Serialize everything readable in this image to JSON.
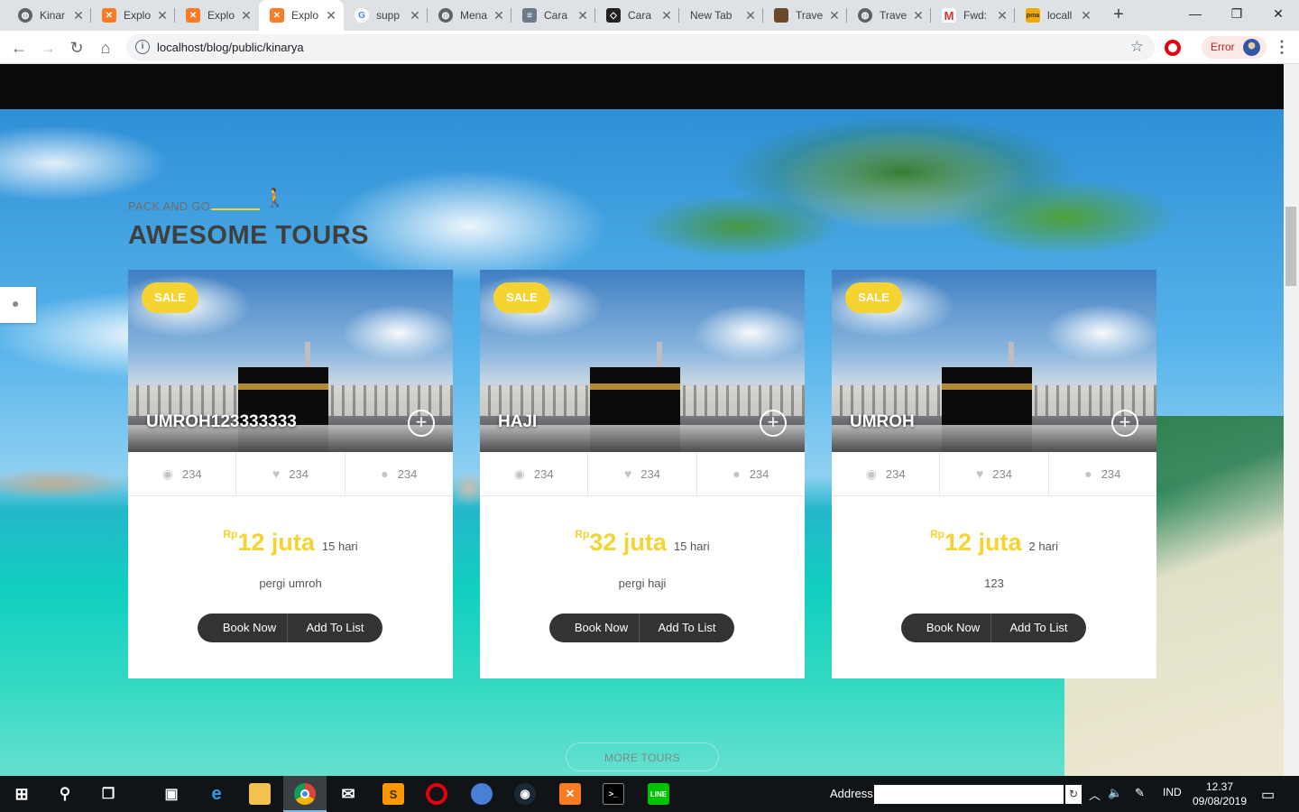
{
  "browser": {
    "tabs": [
      {
        "title": "Kinar",
        "icon": "globe-icon",
        "color": "#5f6368",
        "active": false
      },
      {
        "title": "Explo",
        "icon": "xampp-icon",
        "color": "#fb7a24",
        "active": false
      },
      {
        "title": "Explo",
        "icon": "xampp-icon",
        "color": "#fb7a24",
        "active": false
      },
      {
        "title": "Explo",
        "icon": "xampp-icon",
        "color": "#fb7a24",
        "active": true
      },
      {
        "title": "supp",
        "icon": "google-icon",
        "color": "#4285f4",
        "active": false
      },
      {
        "title": "Mena",
        "icon": "globe-icon",
        "color": "#5f6368",
        "active": false
      },
      {
        "title": "Cara",
        "icon": "db-icon",
        "color": "#6c7a89",
        "active": false
      },
      {
        "title": "Cara",
        "icon": "codepen-icon",
        "color": "#222222",
        "active": false
      },
      {
        "title": "New Tab",
        "icon": "none",
        "color": "",
        "active": false
      },
      {
        "title": "Trave",
        "icon": "photo-icon",
        "color": "#6b4a2b",
        "active": false
      },
      {
        "title": "Trave",
        "icon": "globe-icon",
        "color": "#5f6368",
        "active": false
      },
      {
        "title": "Fwd:",
        "icon": "gmail-icon",
        "color": "#d93025",
        "active": false
      },
      {
        "title": "locall",
        "icon": "phpmyadmin-icon",
        "color": "#f2a900",
        "active": false
      }
    ],
    "url": "localhost/blog/public/kinarya",
    "profile_status": "Error"
  },
  "page": {
    "eyebrow": "PACK AND GO",
    "title": "AWESOME TOURS",
    "more_tours": "MORE TOURS",
    "accent_color": "#f5d431",
    "tours": [
      {
        "badge": "SALE",
        "name": "UMROH123333333",
        "views": "234",
        "likes": "234",
        "comments": "234",
        "currency": "Rp",
        "price": "12 juta",
        "duration": "15 hari",
        "description": "pergi umroh",
        "book_label": "Book Now",
        "list_label": "Add To List"
      },
      {
        "badge": "SALE",
        "name": "HAJI",
        "views": "234",
        "likes": "234",
        "comments": "234",
        "currency": "Rp",
        "price": "32 juta",
        "duration": "15 hari",
        "description": "pergi haji",
        "book_label": "Book Now",
        "list_label": "Add To List"
      },
      {
        "badge": "SALE",
        "name": "UMROH",
        "views": "234",
        "likes": "234",
        "comments": "234",
        "currency": "Rp",
        "price": "12 juta",
        "duration": "2 hari",
        "description": "123",
        "book_label": "Book Now",
        "list_label": "Add To List"
      }
    ]
  },
  "taskbar": {
    "address_label": "Address",
    "language": "IND",
    "time": "12.37",
    "date": "09/08/2019"
  }
}
